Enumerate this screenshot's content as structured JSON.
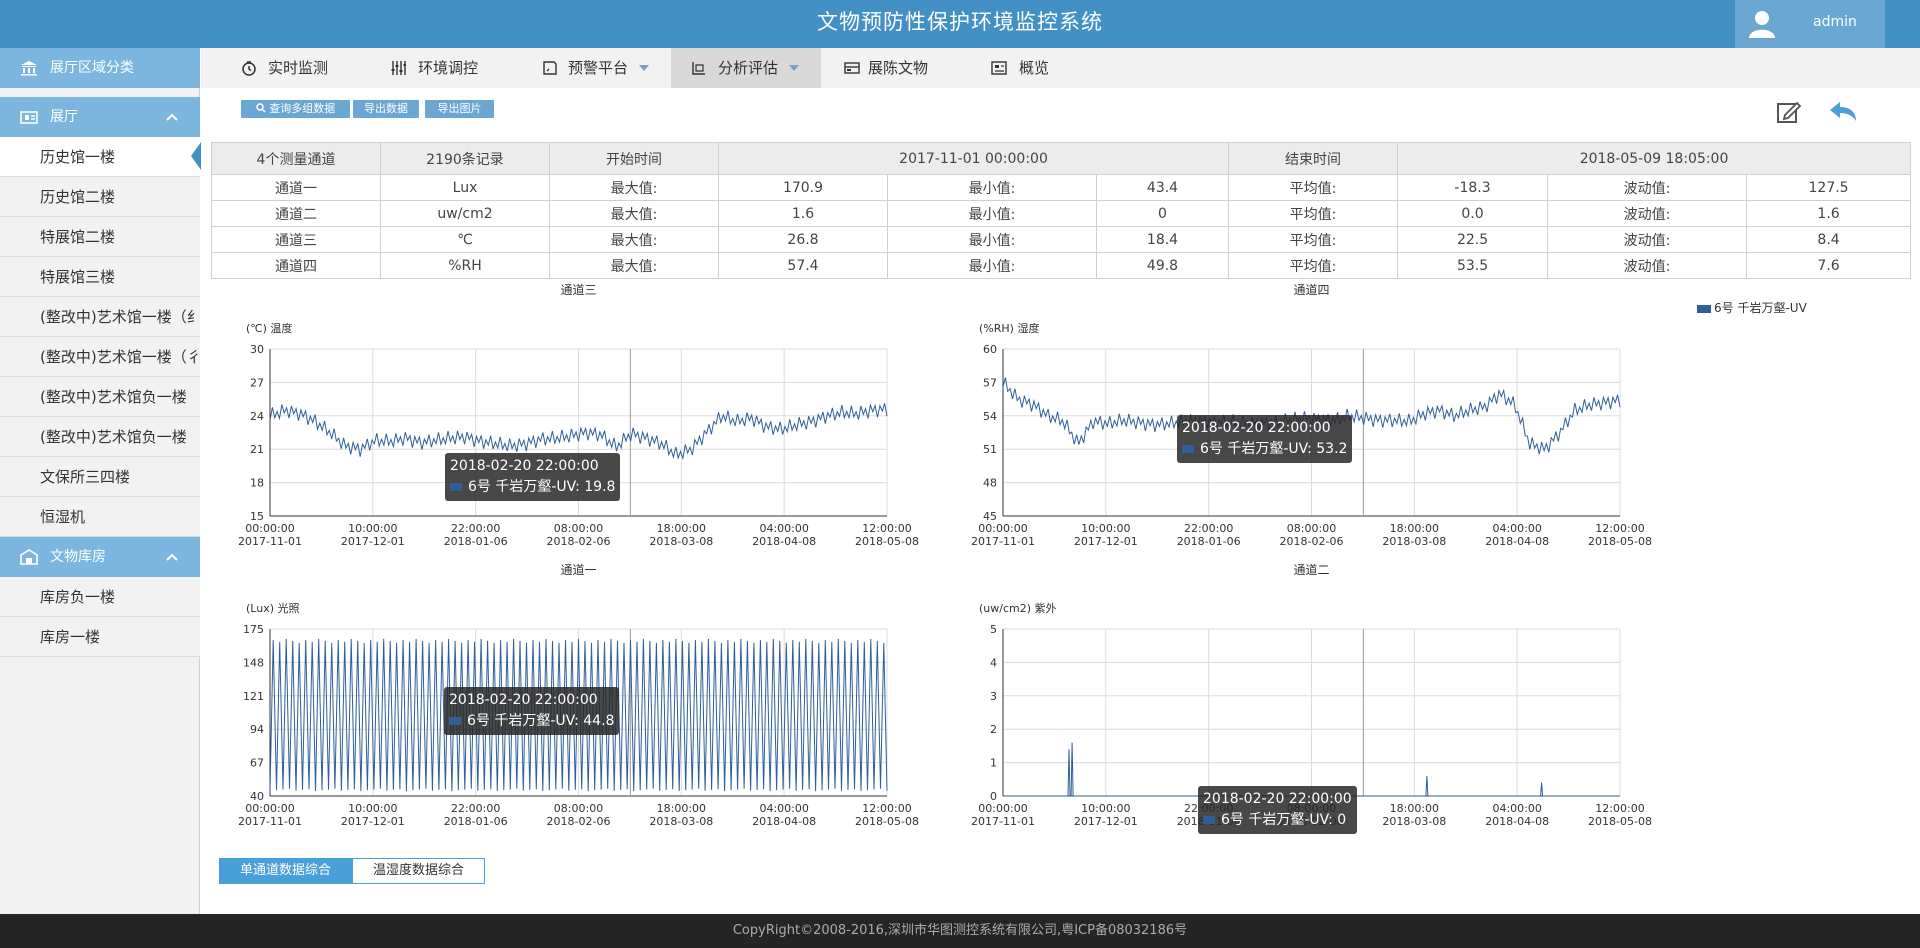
{
  "header": {
    "title": "文物预防性保护环境监控系统",
    "user": "admin"
  },
  "sidebar": {
    "region_header": "展厅区域分类",
    "group1": {
      "label": "展厅",
      "items": [
        "历史馆一楼",
        "历史馆二楼",
        "特展馆二楼",
        "特展馆三楼",
        "(整改中)艺术馆一楼（纟",
        "(整改中)艺术馆一楼（彳",
        "(整改中)艺术馆负一楼",
        "(整改中)艺术馆负一楼",
        "文保所三四楼",
        "恒湿机"
      ]
    },
    "group2": {
      "label": "文物库房",
      "items": [
        "库房负一楼",
        "库房一楼"
      ]
    }
  },
  "nav": {
    "realtime": "实时监测",
    "env": "环境调控",
    "alert": "预警平台",
    "analysis": "分析评估",
    "exhibits": "展陈文物",
    "overview": "概览"
  },
  "toolbar": {
    "query": "查询多组数据",
    "export_data": "导出数据",
    "export_img": "导出图片"
  },
  "stats": {
    "header": [
      "4个测量通道",
      "2190条记录",
      "开始时间",
      "2017-11-01 00:00:00",
      "结束时间",
      "2018-05-09 18:05:00"
    ],
    "rows": [
      [
        "通道一",
        "Lux",
        "最大值:",
        "170.9",
        "最小值:",
        "43.4",
        "平均值:",
        "-18.3",
        "波动值:",
        "127.5"
      ],
      [
        "通道二",
        "uw/cm2",
        "最大值:",
        "1.6",
        "最小值:",
        "0",
        "平均值:",
        "0.0",
        "波动值:",
        "1.6"
      ],
      [
        "通道三",
        "℃",
        "最大值:",
        "26.8",
        "最小值:",
        "18.4",
        "平均值:",
        "22.5",
        "波动值:",
        "8.4"
      ],
      [
        "通道四",
        "%RH",
        "最大值:",
        "57.4",
        "最小值:",
        "49.8",
        "平均值:",
        "53.5",
        "波动值:",
        "7.6"
      ]
    ]
  },
  "legend": "6号 千岩万壑-UV",
  "tabs": {
    "single": "单通道数据综合",
    "th": "温湿度数据综合"
  },
  "footer": "CopyRight©2008-2016,深圳市华图测控系统有限公司,粤ICP备08032186号",
  "colors": {
    "header": "#4390c4",
    "accent": "#6aa7d2",
    "series": "#2f5f9a",
    "footer": "#252526"
  },
  "chart_data": [
    {
      "type": "line",
      "title": "通道三",
      "ylabel": "(℃) 温度",
      "ylim": [
        15,
        30
      ],
      "yticks": [
        15,
        18,
        21,
        24,
        27,
        30
      ],
      "xticks_time": [
        "00:00:00",
        "10:00:00",
        "22:00:00",
        "08:00:00",
        "18:00:00",
        "04:00:00",
        "12:00:00"
      ],
      "xticks_date": [
        "2017-11-01",
        "2017-12-01",
        "2018-01-06",
        "2018-02-06",
        "2018-03-08",
        "2018-04-08",
        "2018-05-08"
      ],
      "series": [
        {
          "name": "6号 千岩万壑-UV",
          "values": [
            24,
            24.5,
            24.2,
            23.5,
            22.5,
            21.3,
            21,
            21.8,
            21.7,
            22,
            21.6,
            21.8,
            22,
            22.1,
            21.7,
            21.5,
            21.3,
            21.5,
            21.9,
            22,
            22.2,
            22.5,
            22.3,
            21.2,
            22.4,
            22,
            21.5,
            20.5,
            21,
            22.5,
            24,
            23.5,
            23.8,
            23,
            22.8,
            23.2,
            23.5,
            24,
            24.3,
            24.2,
            24.5,
            24.6
          ]
        }
      ],
      "tooltip": {
        "time": "2018-02-20 22:00:00",
        "label": "6号 千岩万壑-UV: 19.8"
      }
    },
    {
      "type": "line",
      "title": "通道四",
      "ylabel": "(%RH) 湿度",
      "ylim": [
        45,
        60
      ],
      "yticks": [
        45,
        48,
        51,
        54,
        57,
        60
      ],
      "xticks_time": [
        "00:00:00",
        "10:00:00",
        "22:00:00",
        "08:00:00",
        "18:00:00",
        "04:00:00",
        "12:00:00"
      ],
      "xticks_date": [
        "2017-11-01",
        "2017-12-01",
        "2018-01-06",
        "2018-02-06",
        "2018-03-08",
        "2018-04-08",
        "2018-05-08"
      ],
      "series": [
        {
          "name": "6号 千岩万壑-UV",
          "values": [
            57,
            55.5,
            55,
            54,
            53.5,
            51.5,
            53.5,
            53.3,
            53.6,
            53.4,
            53.2,
            53.3,
            53.5,
            53.6,
            53.4,
            53.5,
            53.4,
            53.3,
            53.4,
            53.6,
            53.8,
            53.7,
            53.6,
            54,
            53.8,
            53.6,
            53.6,
            53.5,
            54.2,
            54.5,
            54,
            54.5,
            54.8,
            56,
            55,
            51.5,
            51,
            52.5,
            54.5,
            55,
            55.2,
            55.4
          ]
        }
      ],
      "tooltip": {
        "time": "2018-02-20 22:00:00",
        "label": "6号 千岩万壑-UV: 53.2"
      }
    },
    {
      "type": "line",
      "title": "通道一",
      "ylabel": "(Lux) 光照",
      "ylim": [
        40,
        175
      ],
      "yticks": [
        40,
        67,
        94,
        121,
        148,
        175
      ],
      "xticks_time": [
        "00:00:00",
        "10:00:00",
        "22:00:00",
        "08:00:00",
        "18:00:00",
        "04:00:00",
        "12:00:00"
      ],
      "xticks_date": [
        "2017-11-01",
        "2017-12-01",
        "2018-01-06",
        "2018-02-06",
        "2018-03-08",
        "2018-04-08",
        "2018-05-08"
      ],
      "series": [
        {
          "name": "6号 千岩万壑-UV",
          "pattern": "daily oscillation",
          "min": 44,
          "max": 167
        }
      ],
      "tooltip": {
        "time": "2018-02-20 22:00:00",
        "label": "6号 千岩万壑-UV: 44.8"
      }
    },
    {
      "type": "line",
      "title": "通道二",
      "ylabel": "(uw/cm2) 紫外",
      "ylim": [
        0,
        5
      ],
      "yticks": [
        0,
        1,
        2,
        3,
        4,
        5
      ],
      "xticks_time": [
        "00:00:00",
        "10:00:00",
        "22:00:00",
        "08:00:00",
        "18:00:00",
        "04:00:00",
        "12:00:00"
      ],
      "xticks_date": [
        "2017-11-01",
        "2017-12-01",
        "2018-01-06",
        "2018-02-06",
        "2018-03-08",
        "2018-04-08",
        "2018-05-08"
      ],
      "series": [
        {
          "name": "6号 千岩万壑-UV",
          "spikes": [
            [
              0.107,
              1.4
            ],
            [
              0.112,
              1.6
            ],
            [
              0.687,
              0.6
            ],
            [
              0.873,
              0.4
            ]
          ]
        }
      ],
      "tooltip": {
        "time": "2018-02-20 22:00:00",
        "label": "6号 千岩万壑-UV: 0"
      }
    }
  ]
}
